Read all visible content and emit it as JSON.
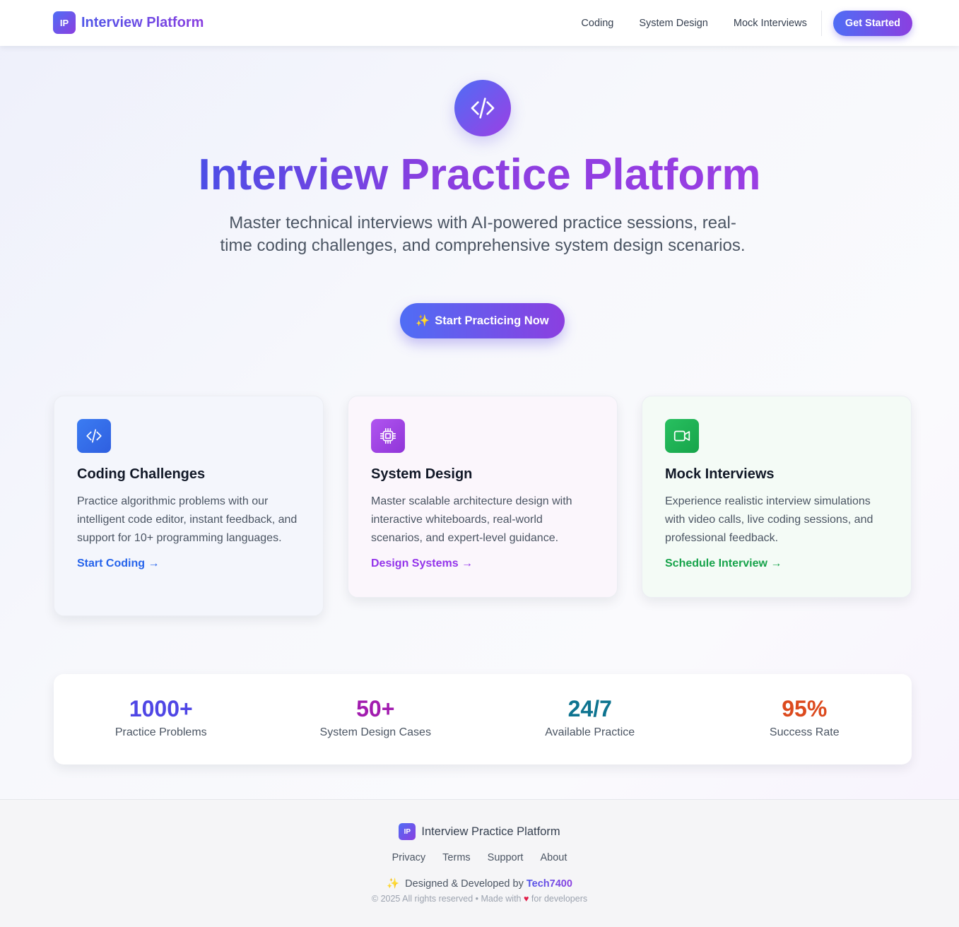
{
  "header": {
    "logo_text": "IP",
    "brand": "Interview Platform",
    "nav": [
      "Coding",
      "System Design",
      "Mock Interviews"
    ],
    "cta": "Get Started"
  },
  "hero": {
    "icon": "code-icon",
    "title": "Interview Practice Platform",
    "subtitle": "Master technical interviews with AI-powered practice sessions, real-time coding challenges, and comprehensive system design scenarios.",
    "cta_icon": "✨",
    "cta": "Start Practicing Now"
  },
  "features": [
    {
      "icon": "code-icon",
      "title": "Coding Challenges",
      "description": "Practice algorithmic problems with our intelligent code editor, instant feedback, and support for 10+ programming languages.",
      "link": "Start Coding →",
      "color": "#2563eb"
    },
    {
      "icon": "cpu-chip-icon",
      "title": "System Design",
      "description": "Master scalable architecture design with interactive whiteboards, real-world scenarios, and expert-level guidance.",
      "link": "Design Systems →",
      "color": "#9333ea"
    },
    {
      "icon": "video-camera-icon",
      "title": "Mock Interviews",
      "description": "Experience realistic interview simulations with video calls, live coding sessions, and professional feedback.",
      "link": "Schedule Interview →",
      "color": "#16a34a"
    }
  ],
  "stats": [
    {
      "value": "1000+",
      "label": "Practice Problems",
      "color": "#4f46e5"
    },
    {
      "value": "50+",
      "label": "System Design Cases",
      "color": "#a21caf"
    },
    {
      "value": "24/7",
      "label": "Available Practice",
      "color": "#0e7490"
    },
    {
      "value": "95%",
      "label": "Success Rate",
      "color": "#dc4a1e"
    }
  ],
  "footer": {
    "logo_text": "IP",
    "brand": "Interview Practice Platform",
    "links": [
      "Privacy",
      "Terms",
      "Support",
      "About"
    ],
    "credit_icon": "✨",
    "credit_prefix": "Designed & Developed by",
    "credit_author": "Tech7400",
    "copyright_prefix": "© 2025 All rights reserved • Made with",
    "copyright_heart": "♥",
    "copyright_suffix": "for developers"
  }
}
